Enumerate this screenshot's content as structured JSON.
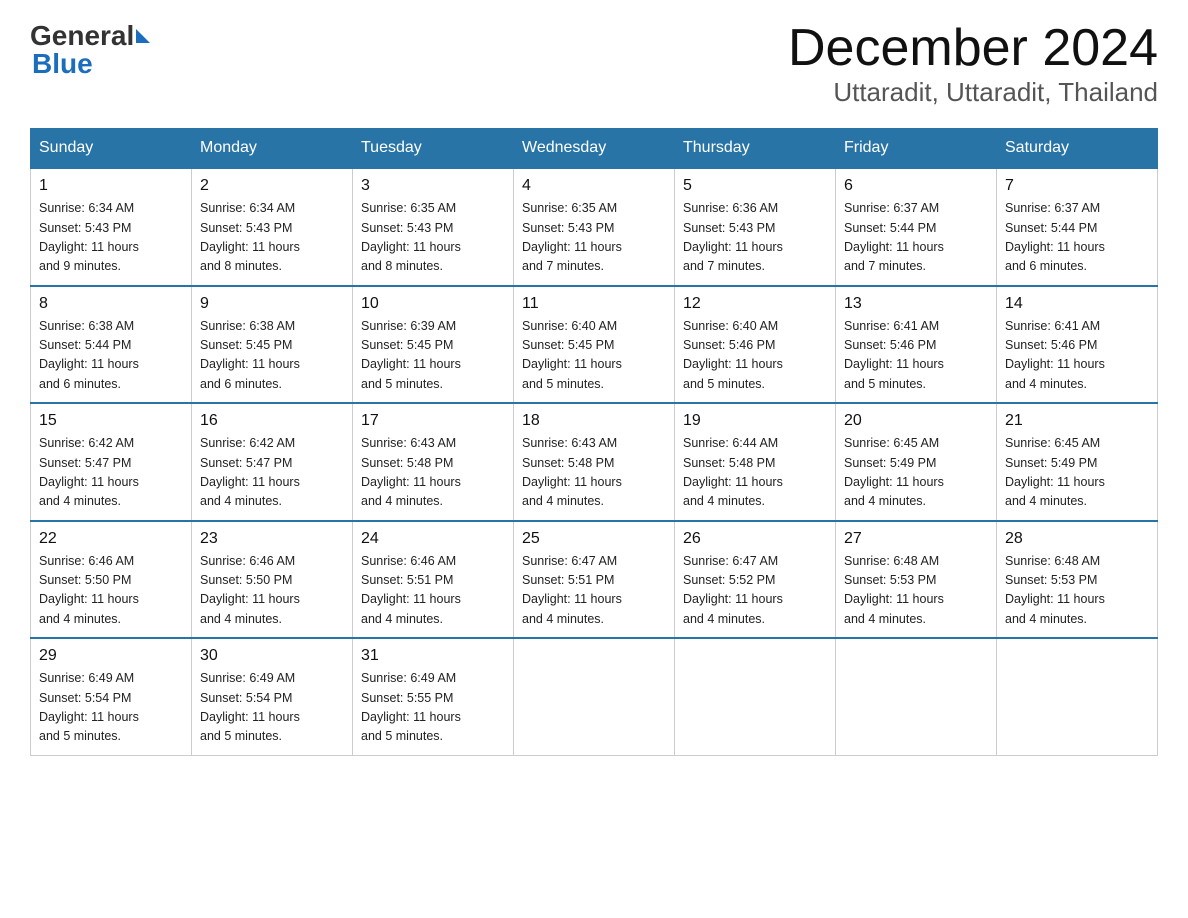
{
  "header": {
    "logo_general": "General",
    "logo_blue": "Blue",
    "month_title": "December 2024",
    "location": "Uttaradit, Uttaradit, Thailand"
  },
  "weekdays": [
    "Sunday",
    "Monday",
    "Tuesday",
    "Wednesday",
    "Thursday",
    "Friday",
    "Saturday"
  ],
  "weeks": [
    [
      {
        "day": "1",
        "sunrise": "6:34 AM",
        "sunset": "5:43 PM",
        "daylight": "11 hours and 9 minutes."
      },
      {
        "day": "2",
        "sunrise": "6:34 AM",
        "sunset": "5:43 PM",
        "daylight": "11 hours and 8 minutes."
      },
      {
        "day": "3",
        "sunrise": "6:35 AM",
        "sunset": "5:43 PM",
        "daylight": "11 hours and 8 minutes."
      },
      {
        "day": "4",
        "sunrise": "6:35 AM",
        "sunset": "5:43 PM",
        "daylight": "11 hours and 7 minutes."
      },
      {
        "day": "5",
        "sunrise": "6:36 AM",
        "sunset": "5:43 PM",
        "daylight": "11 hours and 7 minutes."
      },
      {
        "day": "6",
        "sunrise": "6:37 AM",
        "sunset": "5:44 PM",
        "daylight": "11 hours and 7 minutes."
      },
      {
        "day": "7",
        "sunrise": "6:37 AM",
        "sunset": "5:44 PM",
        "daylight": "11 hours and 6 minutes."
      }
    ],
    [
      {
        "day": "8",
        "sunrise": "6:38 AM",
        "sunset": "5:44 PM",
        "daylight": "11 hours and 6 minutes."
      },
      {
        "day": "9",
        "sunrise": "6:38 AM",
        "sunset": "5:45 PM",
        "daylight": "11 hours and 6 minutes."
      },
      {
        "day": "10",
        "sunrise": "6:39 AM",
        "sunset": "5:45 PM",
        "daylight": "11 hours and 5 minutes."
      },
      {
        "day": "11",
        "sunrise": "6:40 AM",
        "sunset": "5:45 PM",
        "daylight": "11 hours and 5 minutes."
      },
      {
        "day": "12",
        "sunrise": "6:40 AM",
        "sunset": "5:46 PM",
        "daylight": "11 hours and 5 minutes."
      },
      {
        "day": "13",
        "sunrise": "6:41 AM",
        "sunset": "5:46 PM",
        "daylight": "11 hours and 5 minutes."
      },
      {
        "day": "14",
        "sunrise": "6:41 AM",
        "sunset": "5:46 PM",
        "daylight": "11 hours and 4 minutes."
      }
    ],
    [
      {
        "day": "15",
        "sunrise": "6:42 AM",
        "sunset": "5:47 PM",
        "daylight": "11 hours and 4 minutes."
      },
      {
        "day": "16",
        "sunrise": "6:42 AM",
        "sunset": "5:47 PM",
        "daylight": "11 hours and 4 minutes."
      },
      {
        "day": "17",
        "sunrise": "6:43 AM",
        "sunset": "5:48 PM",
        "daylight": "11 hours and 4 minutes."
      },
      {
        "day": "18",
        "sunrise": "6:43 AM",
        "sunset": "5:48 PM",
        "daylight": "11 hours and 4 minutes."
      },
      {
        "day": "19",
        "sunrise": "6:44 AM",
        "sunset": "5:48 PM",
        "daylight": "11 hours and 4 minutes."
      },
      {
        "day": "20",
        "sunrise": "6:45 AM",
        "sunset": "5:49 PM",
        "daylight": "11 hours and 4 minutes."
      },
      {
        "day": "21",
        "sunrise": "6:45 AM",
        "sunset": "5:49 PM",
        "daylight": "11 hours and 4 minutes."
      }
    ],
    [
      {
        "day": "22",
        "sunrise": "6:46 AM",
        "sunset": "5:50 PM",
        "daylight": "11 hours and 4 minutes."
      },
      {
        "day": "23",
        "sunrise": "6:46 AM",
        "sunset": "5:50 PM",
        "daylight": "11 hours and 4 minutes."
      },
      {
        "day": "24",
        "sunrise": "6:46 AM",
        "sunset": "5:51 PM",
        "daylight": "11 hours and 4 minutes."
      },
      {
        "day": "25",
        "sunrise": "6:47 AM",
        "sunset": "5:51 PM",
        "daylight": "11 hours and 4 minutes."
      },
      {
        "day": "26",
        "sunrise": "6:47 AM",
        "sunset": "5:52 PM",
        "daylight": "11 hours and 4 minutes."
      },
      {
        "day": "27",
        "sunrise": "6:48 AM",
        "sunset": "5:53 PM",
        "daylight": "11 hours and 4 minutes."
      },
      {
        "day": "28",
        "sunrise": "6:48 AM",
        "sunset": "5:53 PM",
        "daylight": "11 hours and 4 minutes."
      }
    ],
    [
      {
        "day": "29",
        "sunrise": "6:49 AM",
        "sunset": "5:54 PM",
        "daylight": "11 hours and 5 minutes."
      },
      {
        "day": "30",
        "sunrise": "6:49 AM",
        "sunset": "5:54 PM",
        "daylight": "11 hours and 5 minutes."
      },
      {
        "day": "31",
        "sunrise": "6:49 AM",
        "sunset": "5:55 PM",
        "daylight": "11 hours and 5 minutes."
      },
      null,
      null,
      null,
      null
    ]
  ],
  "labels": {
    "sunrise": "Sunrise:",
    "sunset": "Sunset:",
    "daylight": "Daylight:"
  }
}
